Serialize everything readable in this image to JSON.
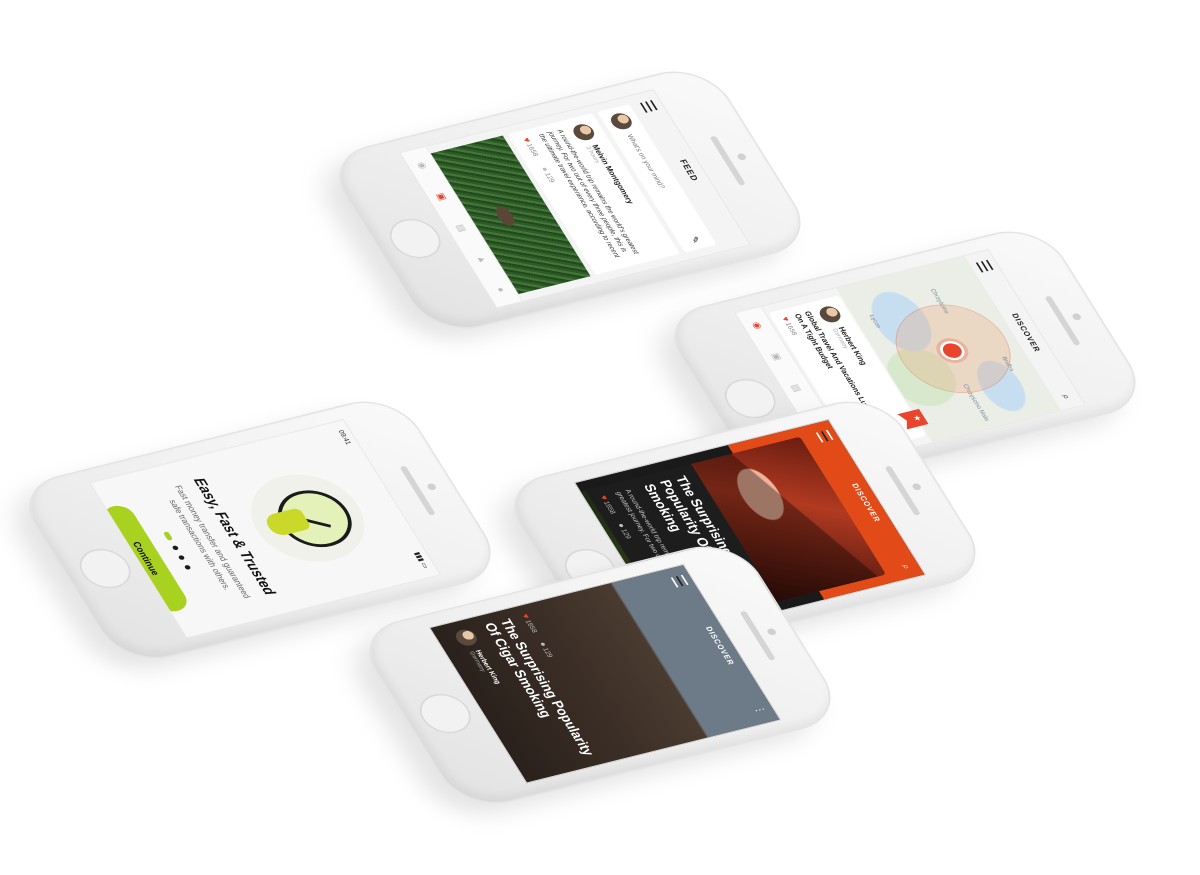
{
  "colors": {
    "accent_orange": "#e8452c",
    "accent_lime": "#a8d21f",
    "phone_body": "#f0f0f0",
    "dark_card": "#1d1d1d"
  },
  "feed_screen": {
    "title": "FEED",
    "menu_icon": "hamburger-menu-icon",
    "compose_placeholder": "What's on your mind?",
    "post": {
      "author": "Melvin Montgomery",
      "subtitle": "3 hours",
      "text": "A round-the-world trip remains the world's greatest journey. For two out of every three people, this is the ultimate travel experience, according to recent",
      "likes": "1658",
      "comments": "129"
    },
    "tabs": [
      "home-icon",
      "feed-icon",
      "gallery-icon",
      "notifications-icon",
      "profile-icon"
    ]
  },
  "onboarding_screen": {
    "status_time": "09:41",
    "title": "Easy, Fast & Trusted",
    "text": "Fast money transfer and guaranteed safe transactions with others.",
    "cta": "Continue",
    "dots": 4,
    "active_dot": 1
  },
  "map_screen": {
    "title": "DISCOVER",
    "map_labels": [
      "Bridha",
      "Chrzęścino",
      "Chrzęścino Mała",
      "Łęcze"
    ],
    "card": {
      "author": "Herbert King",
      "subtitle": "Germany",
      "title": "Global Travel And Vacations Luxury Travel On A Tight Budget",
      "likes": "1658"
    }
  },
  "discover_orange_screen": {
    "title": "DISCOVER",
    "article_1": {
      "title": "The Surprising Popularity Of Cigar Smoking",
      "text": "A round-the-world trip remains the world's greatest journey. For two out of every three",
      "likes": "1658",
      "comments": "129"
    },
    "article_2": {
      "title": "Bryce Canyon A Stunning Us Travel Destination"
    }
  },
  "discover_photo_screen": {
    "title": "DISCOVER",
    "article": {
      "title": "The Surprising Popularity Of Cigar Smoking",
      "likes": "1658",
      "comments": "129",
      "author": "Herbert King",
      "subtitle": "Germany"
    }
  }
}
